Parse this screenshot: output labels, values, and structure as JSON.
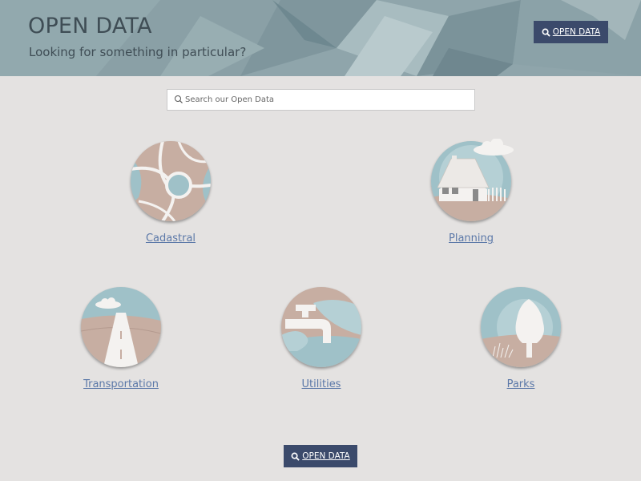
{
  "header": {
    "title": "OPEN DATA",
    "subtitle": "Looking for something in particular?",
    "button_label": "OPEN DATA"
  },
  "search": {
    "placeholder": "Search our Open Data",
    "value": ""
  },
  "categories": [
    {
      "label": "Cadastral",
      "icon": "cadastral-map-icon"
    },
    {
      "label": "Planning",
      "icon": "house-icon"
    },
    {
      "label": "Transportation",
      "icon": "road-icon"
    },
    {
      "label": "Utilities",
      "icon": "water-tap-icon"
    },
    {
      "label": "Parks",
      "icon": "tree-icon"
    }
  ],
  "footer": {
    "button_label": "OPEN DATA"
  },
  "colors": {
    "page_bg": "#e4e2e1",
    "header_bg": "#8fa5ab",
    "button_bg": "#3b4a6b",
    "link": "#5b78a8",
    "icon_blue": "#9fc1c8",
    "icon_tan": "#c7aea2"
  }
}
